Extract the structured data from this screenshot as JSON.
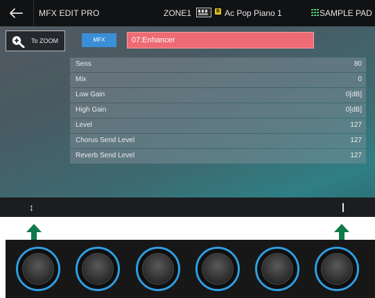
{
  "header": {
    "app_title": "MFX EDIT PRO",
    "zone": "ZONE1",
    "tone_category_badge": "B",
    "tone_name": "Ac Pop Piano 1",
    "sample_pad_label": "SAMPLE PAD"
  },
  "zoom_button": {
    "label": "To ZOOM",
    "icon": "zoom-in-icon"
  },
  "mfx": {
    "button_label": "MFX",
    "type_value": "07:Enhancer"
  },
  "params": [
    {
      "name": "Sens",
      "value": "80"
    },
    {
      "name": "Mix",
      "value": "0"
    },
    {
      "name": "Low Gain",
      "value": "0[dB]"
    },
    {
      "name": "High Gain",
      "value": "0[dB]"
    },
    {
      "name": "Level",
      "value": "127"
    },
    {
      "name": "Chorus Send Level",
      "value": "127"
    },
    {
      "name": "Reverb Send Level",
      "value": "127"
    }
  ],
  "bottom_bar": {
    "left_icon": "up-down-arrow-icon",
    "left_glyph": "↕",
    "right_icon": "vertical-bar-icon"
  },
  "colors": {
    "mfx_button": "#3a8fd6",
    "type_field": "#ee6b74",
    "knob_ring": "#2f9fe4",
    "arrow": "#0f7a4a",
    "pad_grid": "#59c97a",
    "badge": "#e6c31c"
  }
}
